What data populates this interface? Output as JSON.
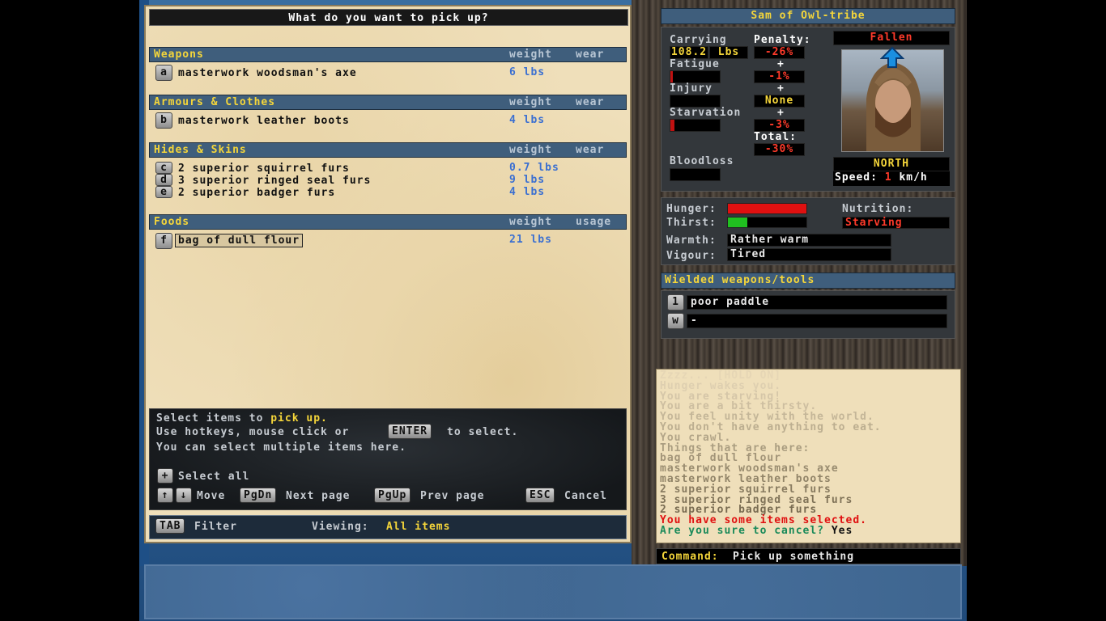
{
  "dialog": {
    "title": "What do you want to pick up?",
    "categories": [
      {
        "name": "Weapons",
        "col1": "weight",
        "col2": "wear"
      },
      {
        "name": "Armours & Clothes",
        "col1": "weight",
        "col2": "wear"
      },
      {
        "name": "Hides & Skins",
        "col1": "weight",
        "col2": "wear"
      },
      {
        "name": "Foods",
        "col1": "weight",
        "col2": "usage"
      }
    ],
    "items": [
      {
        "key": "a",
        "name": "masterwork woodsman's axe",
        "weight": "6 lbs"
      },
      {
        "key": "b",
        "name": "masterwork leather boots",
        "weight": "4 lbs"
      },
      {
        "key": "c",
        "name": "2 superior squirrel furs",
        "weight": "0.7 lbs"
      },
      {
        "key": "d",
        "name": "3 superior ringed seal furs",
        "weight": "9 lbs"
      },
      {
        "key": "e",
        "name": "2 superior badger furs",
        "weight": "4 lbs"
      },
      {
        "key": "f",
        "name": "bag of dull flour",
        "weight": "21 lbs"
      }
    ],
    "help": {
      "line1_pre": "Select items to",
      "line1_hl": "pick up.",
      "line2_pre": "Use hotkeys, mouse click or",
      "line2_key": "ENTER",
      "line2_post": "to select.",
      "line3": "You can select multiple items here.",
      "select_all_key": "+",
      "select_all": "Select all",
      "up_key": "↑",
      "down_key": "↓",
      "move": "Move",
      "pgdn_key": "PgDn",
      "next_page": "Next page",
      "pgup_key": "PgUp",
      "prev_page": "Prev page",
      "esc_key": "ESC",
      "cancel": "Cancel"
    },
    "filter": {
      "tab_key": "TAB",
      "filter_label": "Filter",
      "viewing_label": "Viewing:",
      "viewing_value": "All items"
    }
  },
  "character": {
    "name": "Sam of Owl-tribe",
    "carrying_label": "Carrying",
    "carrying_value": "108.2",
    "carrying_unit": "Lbs",
    "penalty_label": "Penalty:",
    "fatigue_label": "Fatigue",
    "injury_label": "Injury",
    "starvation_label": "Starvation",
    "bloodloss_label": "Bloodloss",
    "penalty_carry": "-26%",
    "penalty_fatigue": "-1%",
    "penalty_injury": "None",
    "penalty_starvation": "-3%",
    "total_label": "Total:",
    "penalty_total": "-30%",
    "plus": "+",
    "status": "Fallen",
    "direction": "NORTH",
    "speed_label": "Speed:",
    "speed_value": "1",
    "speed_unit": "km/h",
    "fatigue_level": 0.05,
    "starvation_level": 0.08
  },
  "needs": {
    "hunger_label": "Hunger:",
    "thirst_label": "Thirst:",
    "nutrition_label": "Nutrition:",
    "nutrition_value": "Starving",
    "warmth_label": "Warmth:",
    "warmth_value": "Rather warm",
    "vigour_label": "Vigour:",
    "vigour_value": "Tired",
    "hunger_level": 1.0,
    "thirst_level": 0.25,
    "hunger_color": "#e01010",
    "thirst_color": "#20c020"
  },
  "wielded": {
    "title": "Wielded weapons/tools",
    "slots": [
      {
        "key": "1",
        "value": "poor paddle"
      },
      {
        "key": "w",
        "value": "-"
      }
    ]
  },
  "log": {
    "messages": [
      "Zzzz... [HOLD ON]",
      "Hunger wakes you.",
      "You are starving!",
      "You are a bit thirsty.",
      "You feel unity with the world.",
      "You don't have anything to eat.",
      "You crawl.",
      "Things that are here:",
      "bag of dull flour",
      "masterwork woodsman's axe",
      "masterwork leather boots",
      "2 superior squirrel furs",
      "3 superior ringed seal furs",
      "2 superior badger furs"
    ],
    "alert": "You have some items selected.",
    "question": "Are you sure to cancel?",
    "answer": "Yes"
  },
  "command": {
    "label": "Command:",
    "value": "Pick up something"
  }
}
